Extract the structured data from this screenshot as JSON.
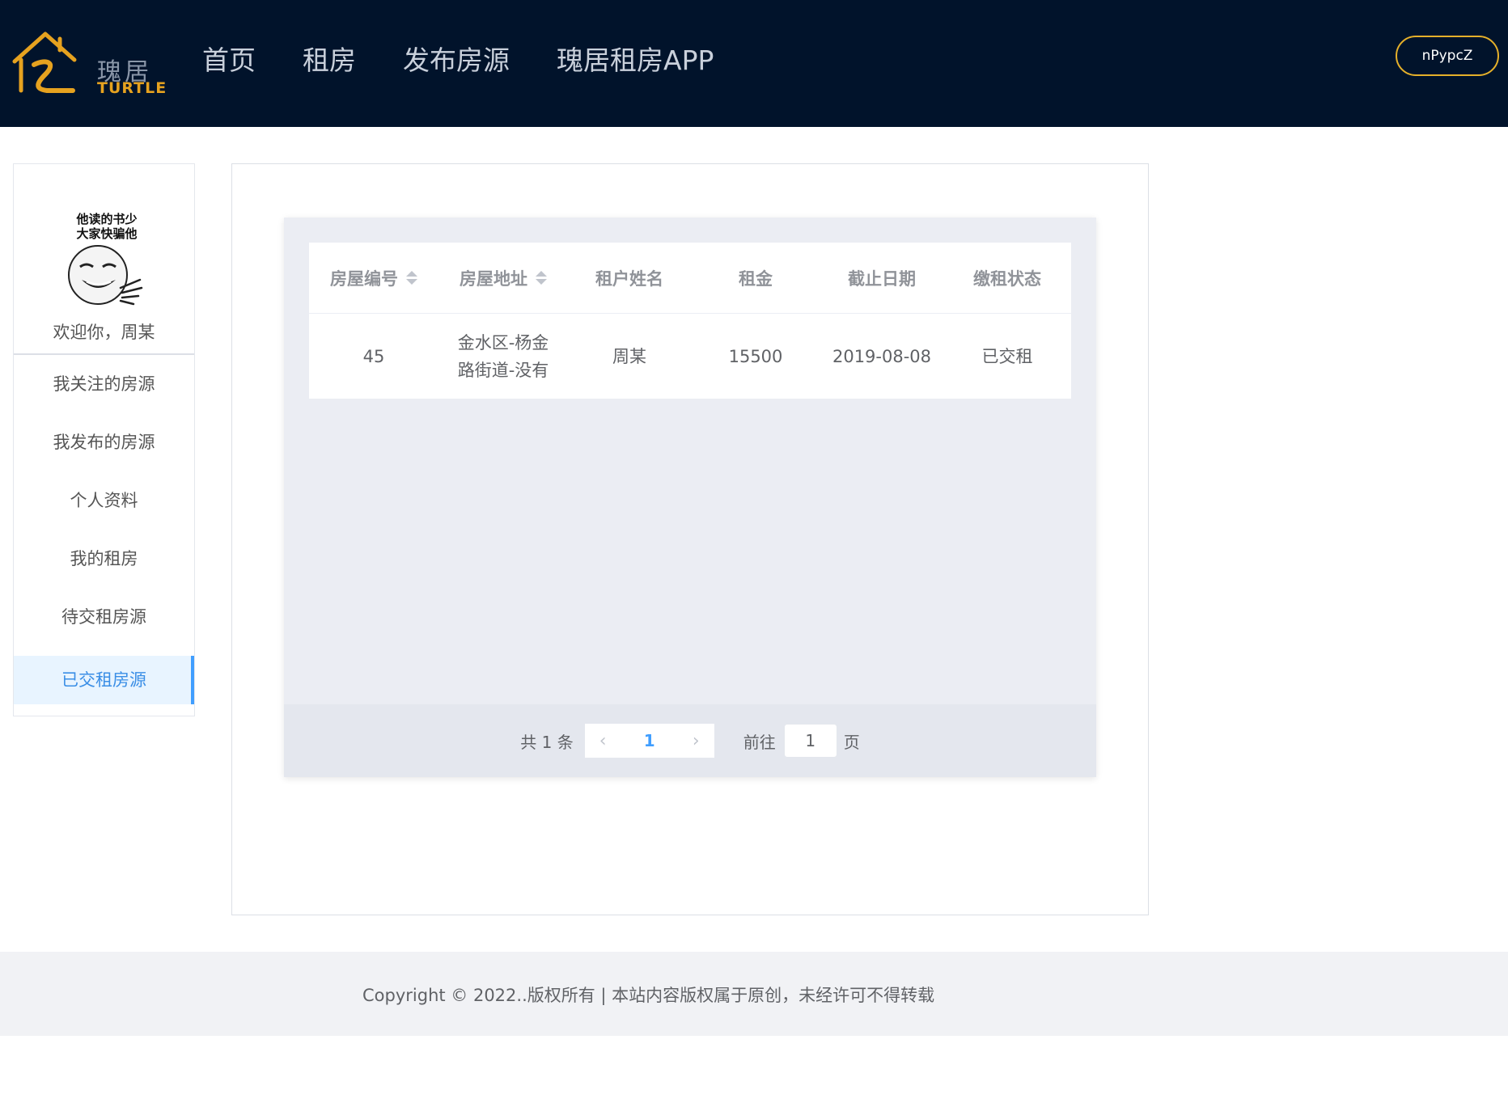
{
  "header": {
    "logo_cn": "瑰居",
    "logo_en": "TURTLE",
    "nav": [
      "首页",
      "租房",
      "发布房源",
      "瑰居租房APP"
    ],
    "user_button": "nPypcZ"
  },
  "sidebar": {
    "avatar_text": [
      "他读的书少",
      "大家快骗他"
    ],
    "welcome": "欢迎你，周某",
    "menu": [
      "我关注的房源",
      "我发布的房源",
      "个人资料",
      "我的租房",
      "待交租房源",
      "已交租房源"
    ],
    "active_index": 5
  },
  "table": {
    "columns": [
      "房屋编号",
      "房屋地址",
      "租户姓名",
      "租金",
      "截止日期",
      "缴租状态"
    ],
    "rows": [
      {
        "id": "45",
        "address": "金水区-杨金路街道-没有",
        "tenant": "周某",
        "rent": "15500",
        "deadline": "2019-08-08",
        "status": "已交租"
      }
    ]
  },
  "pagination": {
    "total_label": "共 1 条",
    "prev_icon": "chevron-left-icon",
    "current_page": "1",
    "next_icon": "chevron-right-icon",
    "goto_label": "前往",
    "goto_value": "1",
    "goto_suffix": "页"
  },
  "footer": {
    "copyright": "Copyright © 2022..版权所有 | 本站内容版权属于原创，未经许可不得转载"
  },
  "colors": {
    "header_bg": "#01132b",
    "accent_gold": "#e5b02a",
    "active_blue": "#409eff",
    "footer_bg": "#f1f2f5"
  }
}
